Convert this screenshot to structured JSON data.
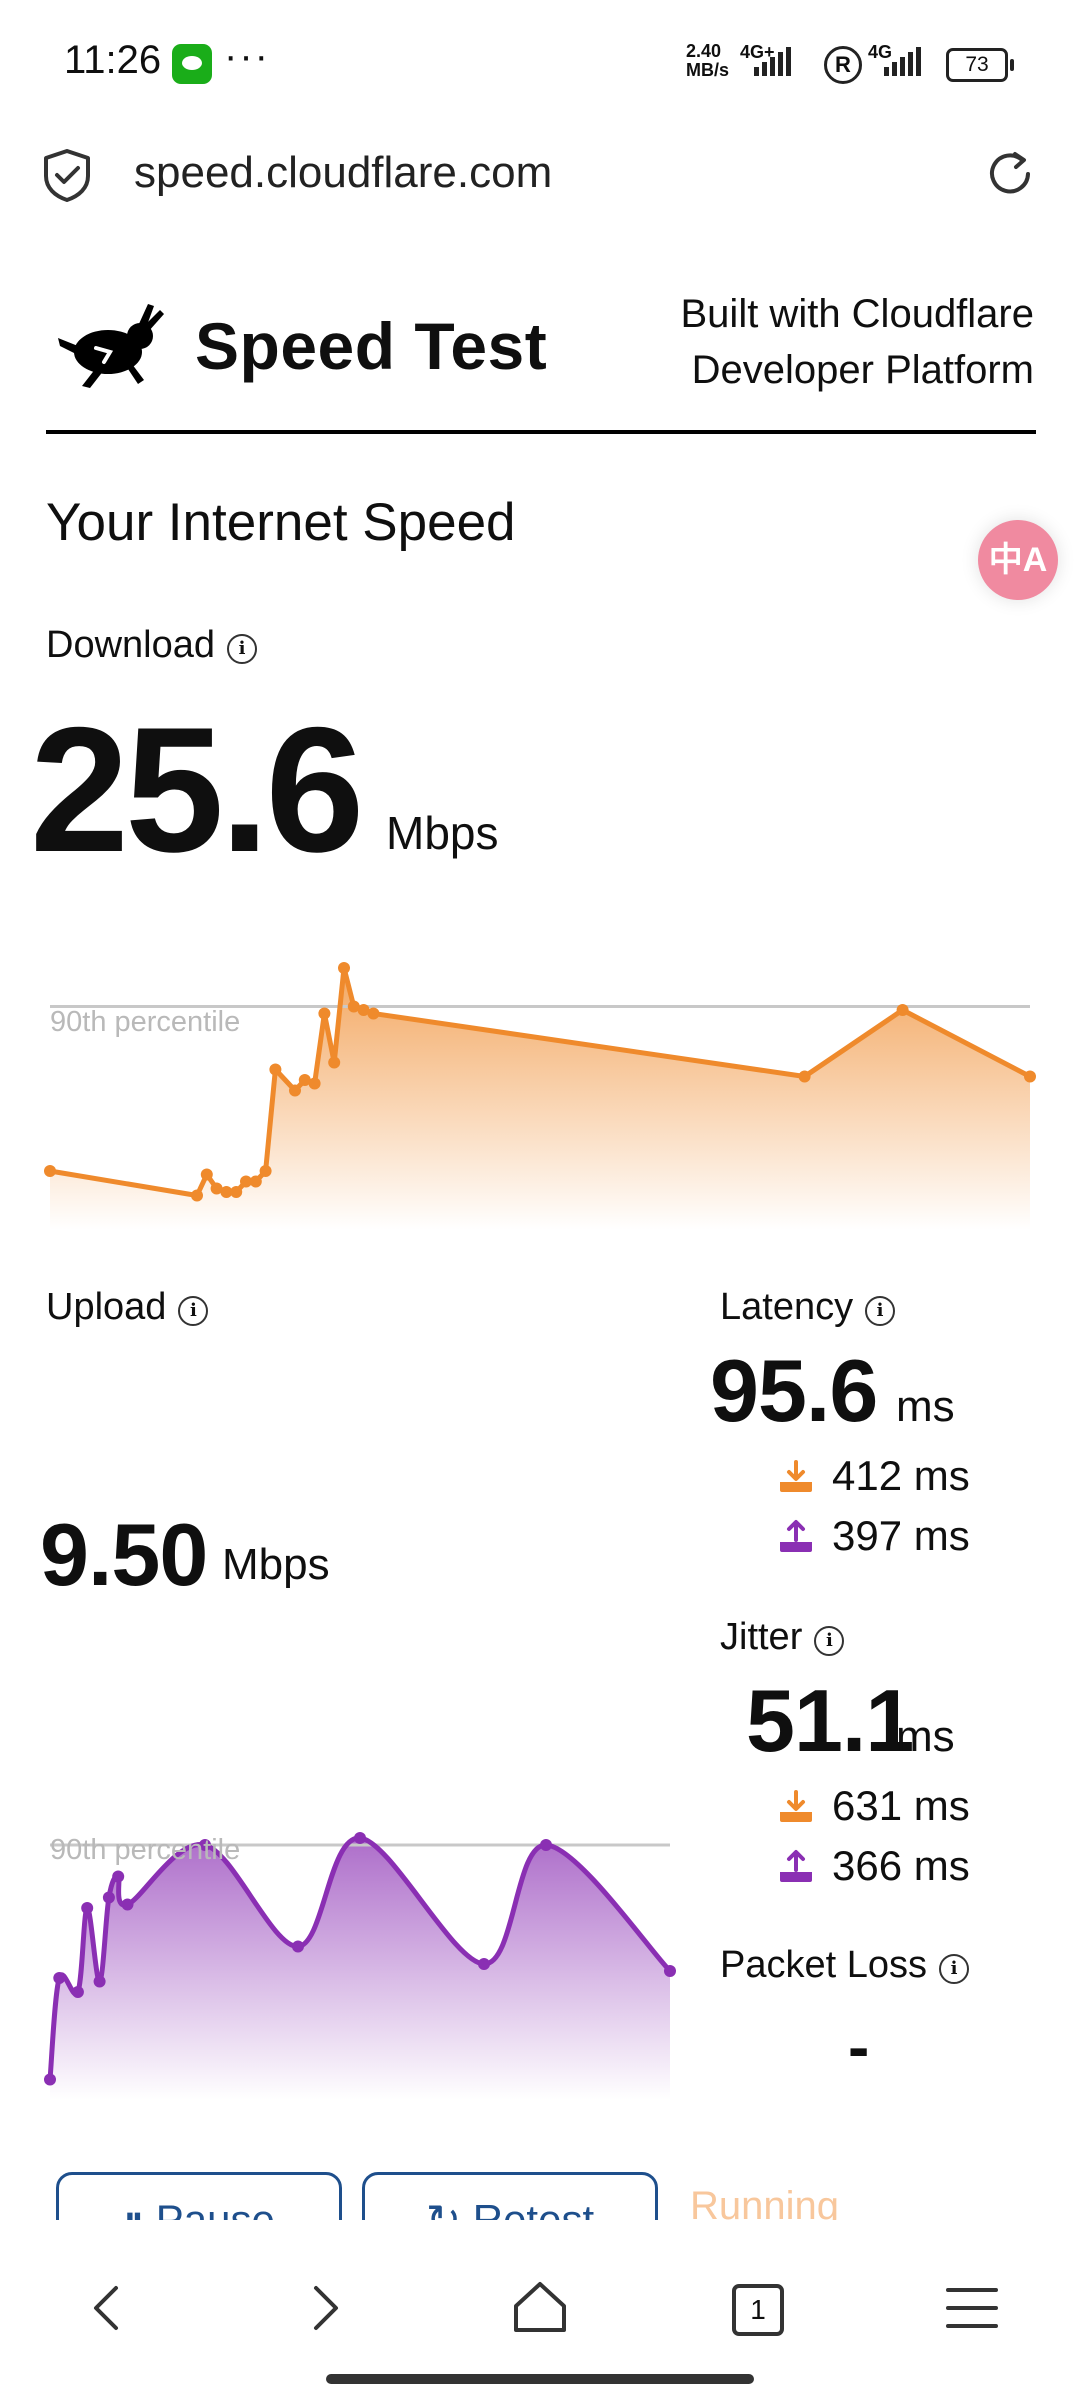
{
  "status_bar": {
    "time": "11:26",
    "more": "···",
    "net_speed": "2.40 MB/s",
    "net_speed_value": "2.40",
    "net_speed_unit": "MB/s",
    "signal1": "4G+",
    "signal2": "4G",
    "roaming": "R",
    "battery": "73"
  },
  "browser": {
    "url": "speed.cloudflare.com",
    "tabs_count": "1"
  },
  "header": {
    "brand": "Speed Test",
    "built_line1": "Built with Cloudflare",
    "built_line2": "Developer Platform"
  },
  "page": {
    "title": "Your Internet Speed",
    "translate_icon": "中A"
  },
  "download": {
    "label": "Download",
    "value": "25.6",
    "unit": "Mbps",
    "percentile_label": "90th percentile"
  },
  "upload": {
    "label": "Upload",
    "value": "9.50",
    "unit": "Mbps",
    "percentile_label": "90th percentile"
  },
  "latency": {
    "label": "Latency",
    "value": "95.6",
    "unit": "ms",
    "down": "412 ms",
    "up": "397 ms"
  },
  "jitter": {
    "label": "Jitter",
    "value": "51.1",
    "unit": "ms",
    "down": "631 ms",
    "up": "366 ms"
  },
  "packet_loss": {
    "label": "Packet Loss",
    "value": "-"
  },
  "controls": {
    "pause": "Pause",
    "retest": "Retest",
    "status": "Running"
  },
  "colors": {
    "download": "#ef8a2c",
    "upload": "#8a2fb3",
    "button": "#1e4f8c"
  },
  "chart_data": [
    {
      "type": "area",
      "series": [
        {
          "x": [
            0,
            15,
            16,
            17,
            18,
            19,
            20,
            21,
            22,
            23,
            25,
            26,
            27,
            28,
            29,
            30,
            31,
            32,
            33,
            77,
            87,
            100
          ],
          "values": [
            14,
            7,
            13,
            9,
            8,
            8,
            11,
            11,
            14,
            43,
            37,
            40,
            39,
            59,
            45,
            72,
            61,
            60,
            59,
            41,
            60,
            41
          ]
        }
      ],
      "xlim": [
        0,
        100
      ],
      "ylim": [
        0,
        80
      ],
      "reference_line": 61,
      "annotations": [
        "90th percentile"
      ]
    },
    {
      "type": "area",
      "series": [
        {
          "x": [
            0,
            1.5,
            4.5,
            6,
            8,
            9.5,
            11,
            12.5,
            25,
            40,
            50,
            70,
            80,
            100
          ],
          "values": [
            3,
            32,
            28,
            52,
            31,
            55,
            61,
            53,
            70,
            41,
            72,
            36,
            70,
            34
          ]
        }
      ],
      "xlim": [
        0,
        100
      ],
      "ylim": [
        0,
        80
      ],
      "reference_line": 70,
      "annotations": [
        "90th percentile"
      ]
    }
  ]
}
